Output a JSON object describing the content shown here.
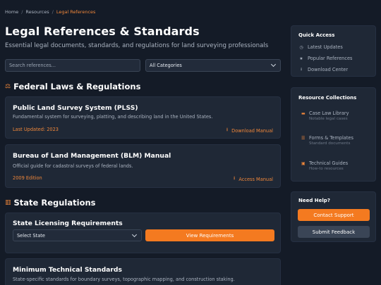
{
  "breadcrumb": {
    "items": [
      "Home",
      "Resources"
    ],
    "current": "Legal References"
  },
  "page": {
    "title": "Legal References & Standards",
    "subtitle": "Essential legal documents, standards, and regulations for land surveying professionals"
  },
  "search": {
    "placeholder": "Search references...",
    "value": ""
  },
  "category_filter": {
    "selected": "All Categories"
  },
  "federal": {
    "heading": "Federal Laws & Regulations",
    "icon": "gavel-icon",
    "cards": [
      {
        "title": "Public Land Survey System (PLSS)",
        "description": "Fundamental system for surveying, platting, and describing land in the United States.",
        "meta": "Last Updated: 2023",
        "action": "Download Manual"
      },
      {
        "title": "Bureau of Land Management (BLM) Manual",
        "description": "Official guide for cadastral surveys of federal lands.",
        "meta": "2009 Edition",
        "action": "Access Manual"
      }
    ]
  },
  "state": {
    "heading": "State Regulations",
    "icon": "map-icon",
    "licensing": {
      "title": "State Licensing Requirements",
      "select_value": "Select State",
      "button": "View Requirements"
    },
    "standards": {
      "title": "Minimum Technical Standards",
      "description": "State-specific standards for boundary surveys, topographic mapping, and construction staking."
    }
  },
  "sidebar": {
    "quick_access": {
      "title": "Quick Access",
      "items": [
        {
          "label": "Latest Updates",
          "icon": "clock-icon"
        },
        {
          "label": "Popular References",
          "icon": "star-icon"
        },
        {
          "label": "Download Center",
          "icon": "download-icon"
        }
      ]
    },
    "collections": {
      "title": "Resource Collections",
      "items": [
        {
          "name": "Case Law Library",
          "sub": "Notable legal cases",
          "icon": "book-icon"
        },
        {
          "name": "Forms & Templates",
          "sub": "Standard documents",
          "icon": "list-icon"
        },
        {
          "name": "Technical Guides",
          "sub": "How-to resources",
          "icon": "guide-icon"
        }
      ]
    },
    "help": {
      "title": "Need Help?",
      "contact": "Contact Support",
      "feedback": "Submit Feedback"
    }
  },
  "colors": {
    "accent": "#f47a20",
    "background": "#141b27",
    "card": "#1f2836"
  }
}
